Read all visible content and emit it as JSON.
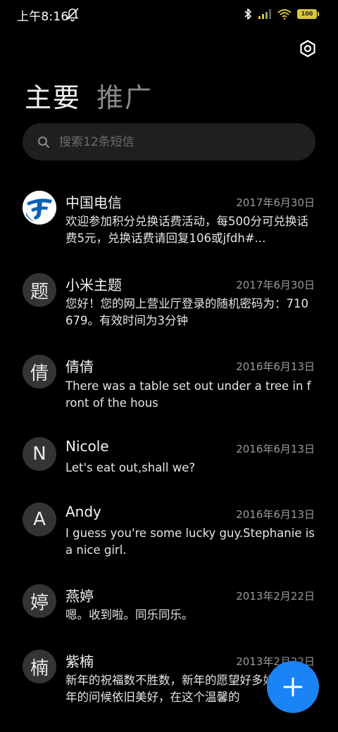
{
  "status_bar": {
    "time": "上午8:16",
    "battery": "100",
    "icons": [
      "mute-icon",
      "bluetooth-icon",
      "signal-icon",
      "wifi-icon",
      "battery-icon"
    ]
  },
  "header": {
    "tabs": [
      {
        "label": "主要",
        "active": true
      },
      {
        "label": "推广",
        "active": false
      }
    ]
  },
  "search": {
    "placeholder": "搜索12条短信"
  },
  "conversations": [
    {
      "sender": "中国电信",
      "date": "2017年6月30日",
      "preview": "欢迎参加积分兑换话费活动，每500分可兑换话费5元，兑换话费请回复106或jfdh#...",
      "avatar": "",
      "avatar_type": "china-telecom-logo"
    },
    {
      "sender": "小米主题",
      "date": "2017年6月30日",
      "preview": "您好！您的网上营业厅登录的随机密码为：710679。有效时间为3分钟",
      "avatar": "题"
    },
    {
      "sender": "倩倩",
      "date": "2016年6月13日",
      "preview": "There was a table set out under a tree in front of the hous",
      "avatar": "倩"
    },
    {
      "sender": "Nicole",
      "date": "2016年6月13日",
      "preview": "Let's eat out,shall we?",
      "avatar": "N"
    },
    {
      "sender": "Andy",
      "date": "2016年6月13日",
      "preview": "I guess you're some lucky guy.Stephanie is a nice girl.",
      "avatar": "A"
    },
    {
      "sender": "燕婷",
      "date": "2013年2月22日",
      "preview": "嗯。收到啦。同乐同乐。",
      "avatar": "婷"
    },
    {
      "sender": "紫楠",
      "date": "2013年2月22日",
      "preview": "新年的祝福数不胜数，新年的愿望好多好多，新年的问候依旧美好，在这个温馨的",
      "avatar": "楠"
    }
  ],
  "colors": {
    "background": "#000000",
    "avatar_bg": "#333436",
    "fab": "#1a83f5",
    "telecom_blue": "#0b62b5"
  }
}
